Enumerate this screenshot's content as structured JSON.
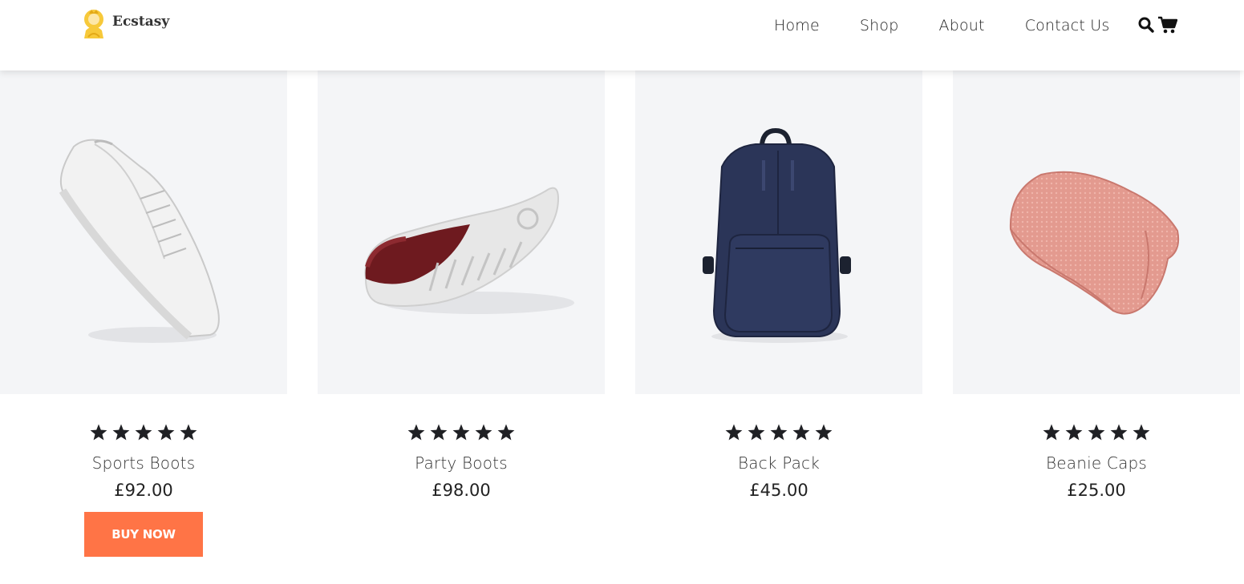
{
  "brand": {
    "name": "Ecstasy",
    "logo_icon": "crowned-woman-logo",
    "accent": "#f7c93a"
  },
  "nav": {
    "items": [
      "Home",
      "Shop",
      "About",
      "Contact Us"
    ],
    "search_icon": "search-icon",
    "cart_icon": "cart-icon"
  },
  "products": [
    {
      "name": "Sports Boots",
      "price": "£92.00",
      "rating": 5,
      "image": "white-sneaker",
      "button": "BUY NOW"
    },
    {
      "name": "Party Boots",
      "price": "£98.00",
      "rating": 5,
      "image": "maroon-suede-shoe",
      "button": ""
    },
    {
      "name": "Back Pack",
      "price": "£45.00",
      "rating": 5,
      "image": "navy-leather-backpack",
      "button": ""
    },
    {
      "name": "Beanie Caps",
      "price": "£25.00",
      "rating": 5,
      "image": "pink-beanie",
      "button": ""
    }
  ],
  "colors": {
    "button": "#ff7446",
    "star": "#1f2024",
    "image_bg": "#f4f5f7"
  }
}
